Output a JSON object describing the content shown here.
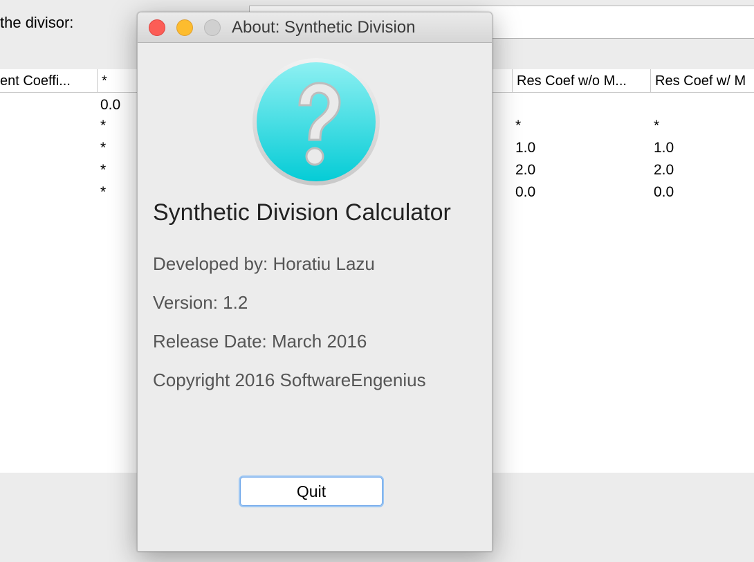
{
  "main": {
    "divisor_label": "the divisor:",
    "table": {
      "headers": [
        "ent Coeffi...",
        "*",
        "Res Coef w/o M...",
        "Res Coef w/ M"
      ],
      "col_star": [
        "0.0",
        "*",
        "*",
        "*",
        "*"
      ],
      "col_res_wo": [
        "*",
        "1.0",
        "2.0",
        "0.0"
      ],
      "col_res_w": [
        "*",
        "1.0",
        "2.0",
        "0.0"
      ]
    }
  },
  "about": {
    "window_title": "About: Synthetic Division",
    "app_name": "Synthetic Division Calculator",
    "developer": "Developed by: Horatiu Lazu",
    "version": "Version: 1.2",
    "release_date": "Release Date: March 2016",
    "copyright": "Copyright 2016 SoftwareEngenius",
    "icon": "question-mark-icon",
    "quit_label": "Quit"
  },
  "colors": {
    "icon_top": "#8ef0f2",
    "icon_bottom": "#05ccd6",
    "close": "#fc5d56",
    "minimize": "#fdbc2e",
    "focus_ring": "#6fa7ea"
  }
}
